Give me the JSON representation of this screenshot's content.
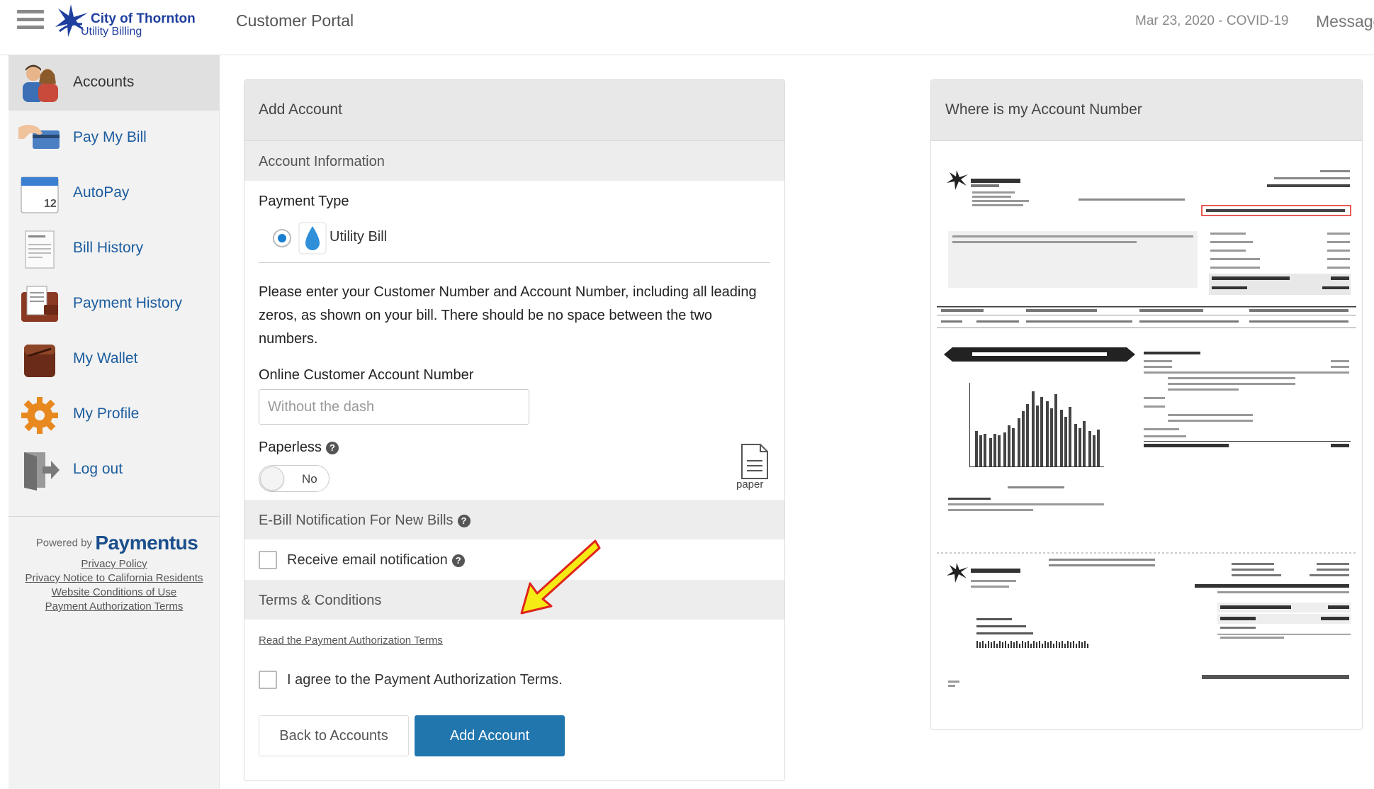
{
  "header": {
    "logo_line1": "City of Thornton",
    "logo_line2": "Utility Billing",
    "portal_title": "Customer Portal",
    "date_note": "Mar 23, 2020 - COVID-19",
    "messages_label": "Messages"
  },
  "sidebar": {
    "items": [
      {
        "label": "Accounts",
        "icon": "accounts-people-icon"
      },
      {
        "label": "Pay My Bill",
        "icon": "hand-card-icon"
      },
      {
        "label": "AutoPay",
        "icon": "calendar-icon"
      },
      {
        "label": "Bill History",
        "icon": "invoices-icon"
      },
      {
        "label": "Payment History",
        "icon": "ledger-icon"
      },
      {
        "label": "My Wallet",
        "icon": "wallet-icon"
      },
      {
        "label": "My Profile",
        "icon": "gear-icon"
      },
      {
        "label": "Log out",
        "icon": "door-exit-icon"
      }
    ],
    "powered_by": "Powered by",
    "brand": "Paymentus",
    "links": [
      "Privacy Policy",
      "Privacy Notice to California Residents",
      "Website Conditions of Use",
      "Payment Authorization Terms"
    ]
  },
  "add_account": {
    "title": "Add Account",
    "account_info_heading": "Account Information",
    "payment_type_label": "Payment Type",
    "utility_bill_label": "Utility Bill",
    "instructions": "Please enter your Customer Number and Account Number, including all leading zeros, as shown on your bill. There should be no space between the two numbers.",
    "account_number_label": "Online Customer Account Number",
    "account_number_placeholder": "Without the dash",
    "account_number_value": "",
    "paperless_label": "Paperless",
    "paperless_toggle": "No",
    "paper_label": "paper",
    "ebill_heading": "E-Bill Notification For New Bills",
    "receive_email_label": "Receive email notification",
    "terms_heading": "Terms & Conditions",
    "terms_link": "Read the Payment Authorization Terms",
    "agree_label": "I agree to the Payment Authorization Terms.",
    "back_button": "Back to Accounts",
    "add_button": "Add Account"
  },
  "account_help": {
    "title": "Where is my Account Number"
  },
  "colors": {
    "link_blue": "#1b5c9e",
    "primary_button": "#2176ae",
    "arrow_yellow": "#f5ea14"
  }
}
